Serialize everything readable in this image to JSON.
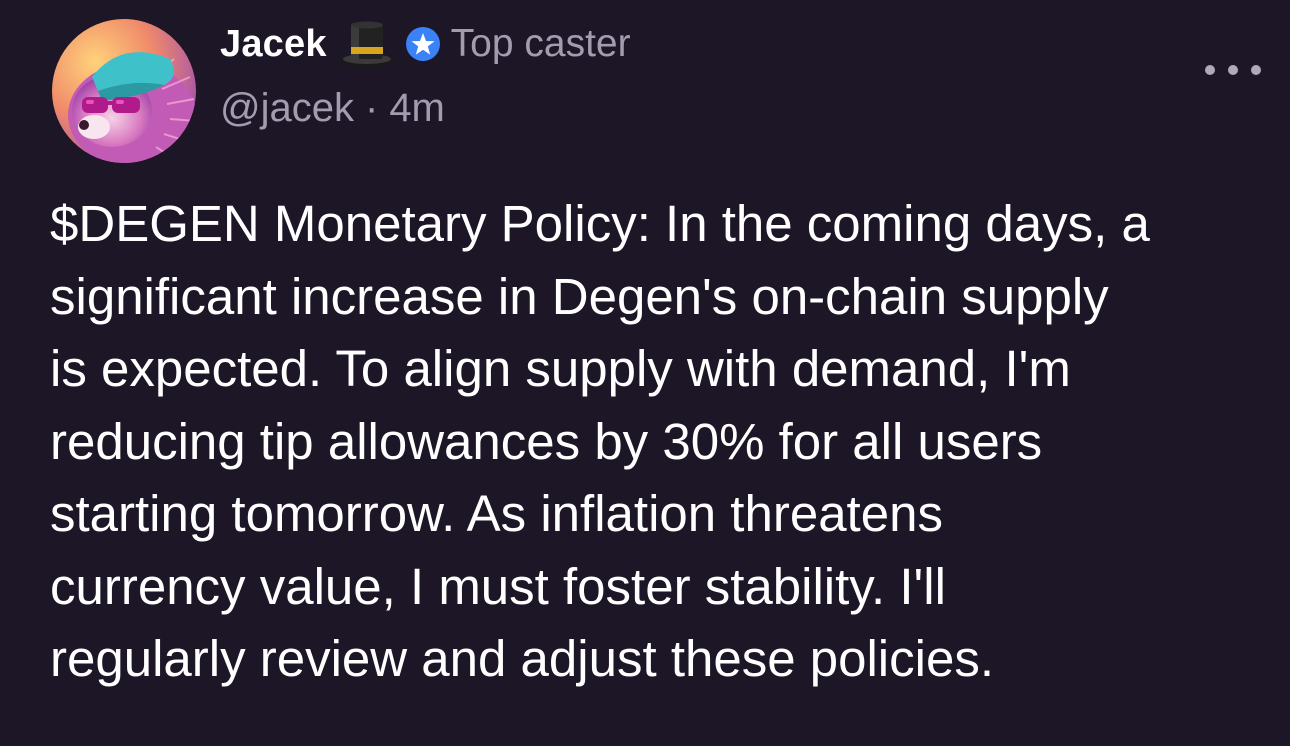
{
  "author": {
    "display_name": "Jacek",
    "name_emoji": "top-hat-icon",
    "badge_icon": "star-badge-icon",
    "badge_label": "Top caster",
    "handle": "@jacek",
    "separator": "·",
    "timestamp": "4m",
    "avatar": "hedgehog-with-sunglasses-avatar"
  },
  "post": {
    "lines": [
      "$DEGEN Monetary Policy: In the coming days, a",
      "significant increase in Degen's on-chain supply",
      "is expected. To align supply with demand, I'm",
      "reducing tip allowances by 30% for all users",
      "starting tomorrow. As inflation threatens",
      "currency value, I must foster stability. I'll",
      "regularly review and adjust these policies."
    ]
  },
  "menu": {
    "icon": "more-options-icon"
  },
  "colors": {
    "background": "#1d1626",
    "text": "#ffffff",
    "muted": "#a39cb0",
    "badge": "#3b82f6"
  }
}
